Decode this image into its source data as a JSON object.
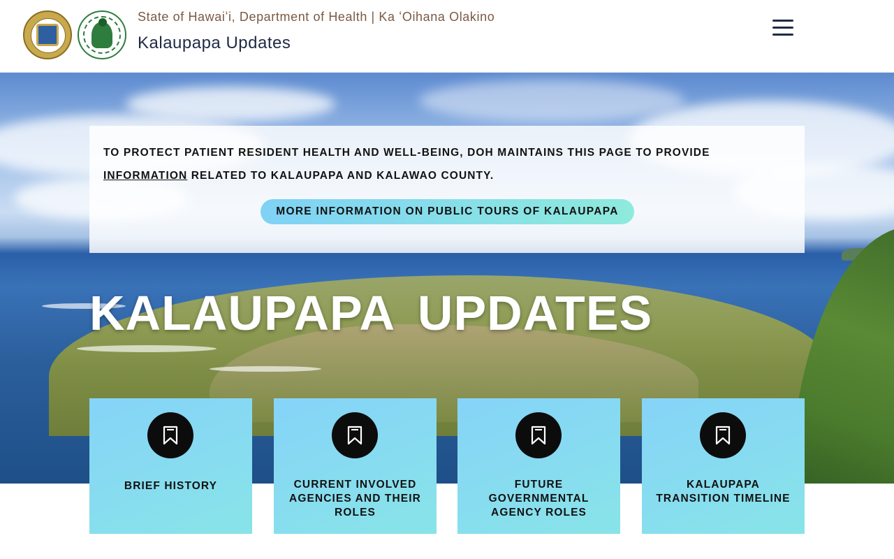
{
  "header": {
    "department_line": "State of Hawaiʻi, Department of Health | Ka ʻOihana Olakino",
    "site_title": "Kalaupapa Updates",
    "logos": [
      "state-of-hawaii-seal",
      "hawaii-state-department-of-health-seal"
    ],
    "menu_icon": "hamburger-menu-icon"
  },
  "hero": {
    "notice_text_before_link": "TO PROTECT PATIENT RESIDENT HEALTH AND WELL-BEING, DOH MAINTAINS THIS PAGE TO PROVIDE",
    "notice_link": "INFORMATION",
    "notice_text_after_link": " RELATED TO KALAUPAPA AND KALAWAO COUNTY.",
    "tours_button": "MORE INFORMATION ON PUBLIC TOURS OF KALAUPAPA",
    "title": "KALAUPAPA UPDATES"
  },
  "cards": [
    {
      "label": "BRIEF HISTORY",
      "icon": "bookmark-icon"
    },
    {
      "label": "CURRENT INVOLVED AGENCIES AND THEIR ROLES",
      "icon": "bookmark-icon"
    },
    {
      "label": "FUTURE GOVERNMENTAL AGENCY ROLES",
      "icon": "bookmark-icon"
    },
    {
      "label": "KALAUPAPA TRANSITION TIMELINE",
      "icon": "bookmark-icon"
    }
  ],
  "colors": {
    "card_gradient_start": "#86d3f8",
    "card_gradient_end": "#88e4e8",
    "button_gradient_start": "#7fd2f5",
    "button_gradient_end": "#8eeadc",
    "department_text": "#7a5a43",
    "title_text": "#1f2a44"
  }
}
